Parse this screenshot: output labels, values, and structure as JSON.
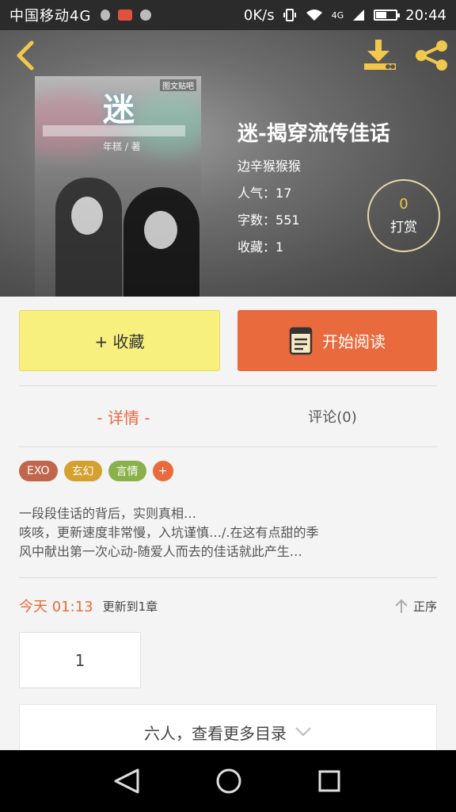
{
  "status_bar": {
    "carrier": "中国移动4G",
    "speed": "0K/s",
    "network": "4G",
    "time": "20:44",
    "battery_level": 0.55
  },
  "header": {
    "icons": [
      "back-arrow",
      "download",
      "share"
    ]
  },
  "book": {
    "title": "迷-揭穿流传佳话",
    "author": "边辛猴猴猴",
    "popularity_label": "人气：",
    "popularity": "17",
    "words_label": "字数：",
    "words": "551",
    "favorites_label": "收藏：",
    "favorites": "1",
    "cover_text": {
      "title_char": "迷",
      "author_tag": "年糕 / 著",
      "badge": "图文贴吧"
    }
  },
  "tip": {
    "count": "0",
    "label": "打赏"
  },
  "actions": {
    "favorite_label": "+  收藏",
    "read_label": "开始阅读"
  },
  "tabs": {
    "detail": "-  详情  -",
    "comments": "评论(0)"
  },
  "tags": [
    {
      "label": "EXO",
      "color": "#c0664a"
    },
    {
      "label": "玄幻",
      "color": "#d4a030"
    },
    {
      "label": "言情",
      "color": "#8ab04a"
    },
    {
      "label": "+",
      "color": "#e96a3c"
    }
  ],
  "description": [
    "一段段佳话的背后，实则真相…",
    "咳咳，更新速度非常慢，入坑谨慎…/.在这有点甜的季",
    "风中献出第一次心动-随爱人而去的佳话就此产生…"
  ],
  "update": {
    "time": "今天 01:13",
    "text": "更新到1章",
    "sort_label": "正序"
  },
  "chapters": [
    "1"
  ],
  "more_label": "六人，查看更多目录",
  "colors": {
    "accent": "#e96a3c",
    "favorite_button": "#f7f07f",
    "tip_count": "#f1c84b"
  }
}
